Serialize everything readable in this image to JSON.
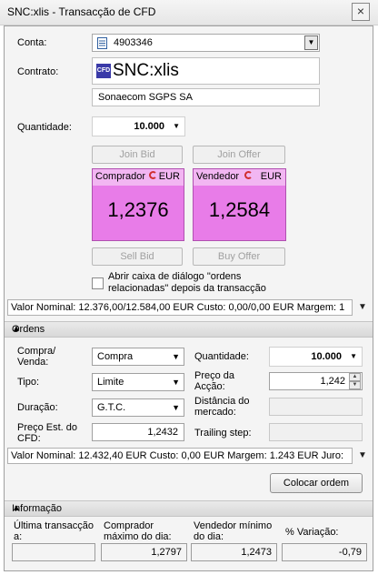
{
  "window": {
    "title": "SNC:xlis - Transacção de CFD",
    "close": "×"
  },
  "account": {
    "label": "Conta:",
    "value": "4903346"
  },
  "contract": {
    "label": "Contrato:",
    "badge": "CFD",
    "symbol": "SNC:xlis",
    "name": "Sonaecom SGPS SA"
  },
  "quantity": {
    "label": "Quantidade:",
    "value": "10.000"
  },
  "buttons": {
    "join_bid": "Join Bid",
    "join_offer": "Join Offer",
    "sell_bid": "Sell Bid",
    "buy_offer": "Buy Offer"
  },
  "bid": {
    "label": "Comprador",
    "currency": "EUR",
    "price": "1,2376"
  },
  "ask": {
    "label": "Vendedor",
    "currency": "EUR",
    "price": "1,2584"
  },
  "checkbox": {
    "line1": "Abrir caixa de diálogo \"ordens",
    "line2": "relacionadas\" depois da transacção"
  },
  "summary1": {
    "text": "Valor Nominal: 12.376,00/12.584,00 EUR   Custo: 0,00/0,00 EUR   Margem: 1"
  },
  "orders": {
    "section": "Ordens",
    "side_label_1": "Compra/",
    "side_label_2": "Venda:",
    "side_value": "Compra",
    "type_label": "Tipo:",
    "type_value": "Limite",
    "duration_label": "Duração:",
    "duration_value": "G.T.C.",
    "est_label_1": "Preço Est. do",
    "est_label_2": "CFD:",
    "est_value": "1,2432",
    "qty_label": "Quantidade:",
    "qty_value": "10.000",
    "price_label_1": "Preço da",
    "price_label_2": "Acção:",
    "price_value": "1,242",
    "dist_label_1": "Distância do",
    "dist_label_2": "mercado:",
    "trail_label": "Trailing step:",
    "summary": "Valor Nominal: 12.432,40 EUR   Custo: 0,00 EUR   Margem: 1.243 EUR   Juro:",
    "place_order": "Colocar ordem"
  },
  "info": {
    "section": "Informação",
    "last_label_1": "Última transacção",
    "last_label_2": "a:",
    "last_value": "",
    "buyer_label_1": "Comprador",
    "buyer_label_2": "máximo do dia:",
    "buyer_value": "1,2797",
    "seller_label_1": "Vendedor mínimo",
    "seller_label_2": "do dia:",
    "seller_value": "1,2473",
    "change_label": "% Variação:",
    "change_value": "-0,79"
  }
}
